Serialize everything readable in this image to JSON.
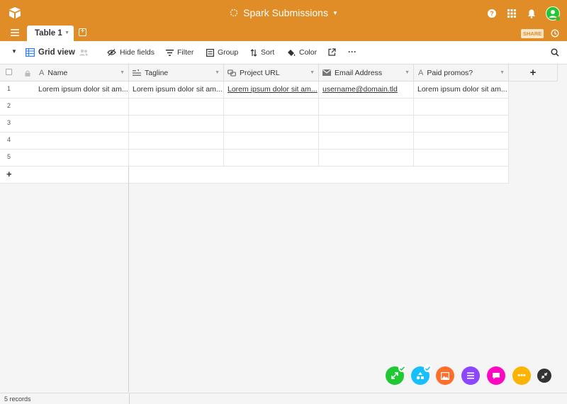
{
  "app": {
    "title": "Spark Submissions"
  },
  "tabs": [
    {
      "label": "Table 1"
    }
  ],
  "share_label": "SHARE",
  "toolbar": {
    "view_name": "Grid view",
    "hide_fields": "Hide fields",
    "filter": "Filter",
    "group": "Group",
    "sort": "Sort",
    "color": "Color",
    "more": "···"
  },
  "columns": [
    {
      "label": "Name",
      "icon": "text-icon"
    },
    {
      "label": "Tagline",
      "icon": "long-text-icon"
    },
    {
      "label": "Project URL",
      "icon": "url-icon"
    },
    {
      "label": "Email Address",
      "icon": "email-icon"
    },
    {
      "label": "Paid promos?",
      "icon": "text-icon"
    }
  ],
  "add_column": "+",
  "rows": [
    {
      "num": "1",
      "cells": [
        "Lorem ipsum dolor sit am...",
        "Lorem ipsum dolor sit am...",
        "Lorem ipsum dolor sit am...",
        "username@domain.tld",
        "Lorem ipsum dolor sit am..."
      ]
    },
    {
      "num": "2",
      "cells": [
        "",
        "",
        "",
        "",
        ""
      ]
    },
    {
      "num": "3",
      "cells": [
        "",
        "",
        "",
        "",
        ""
      ]
    },
    {
      "num": "4",
      "cells": [
        "",
        "",
        "",
        "",
        ""
      ]
    },
    {
      "num": "5",
      "cells": [
        "",
        "",
        "",
        "",
        ""
      ]
    }
  ],
  "add_row": "+",
  "footer": {
    "records": "5 records"
  },
  "colors": {
    "brand": "#e08d27"
  },
  "fabs": [
    {
      "name": "expand-app",
      "color": "#20c933"
    },
    {
      "name": "apps-app",
      "color": "#18bfff"
    },
    {
      "name": "image-app",
      "color": "#ff6f2c"
    },
    {
      "name": "list-app",
      "color": "#8b46ff"
    },
    {
      "name": "chat-app",
      "color": "#ff08c2"
    },
    {
      "name": "more-app",
      "color": "#fcb400"
    },
    {
      "name": "collapse-app",
      "color": "#333333"
    }
  ]
}
